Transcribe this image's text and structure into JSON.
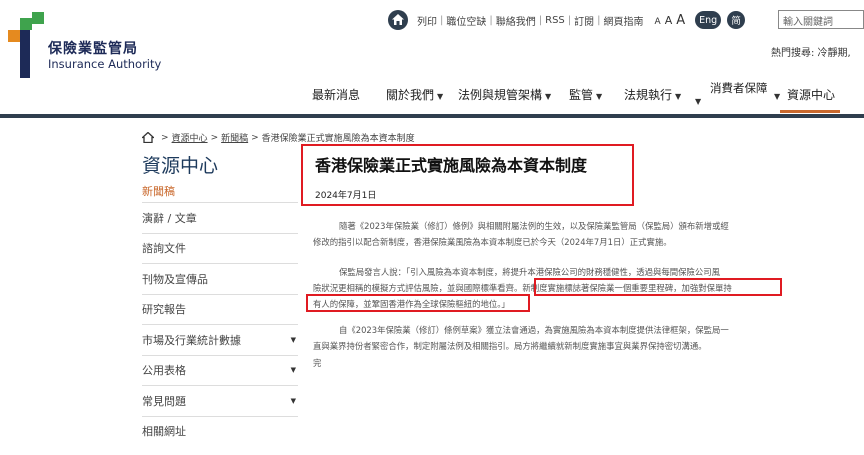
{
  "logo": {
    "zh": "保險業監管局",
    "en": "Insurance Authority"
  },
  "utility": {
    "links": [
      "列印",
      "職位空缺",
      "聯絡我們",
      "RSS",
      "訂閱",
      "網頁指南"
    ],
    "font_sizes": [
      "A",
      "A",
      "A"
    ],
    "lang_en": "Eng",
    "lang_sc": "简",
    "search_placeholder": "輸入關鍵詞",
    "hot_search": "熱門搜尋: 冷靜期,"
  },
  "nav": {
    "items": [
      "最新消息",
      "關於我們",
      "法例與規管架構",
      "監管",
      "法規執行",
      "消費者保障",
      "資源中心"
    ],
    "active": "資源中心"
  },
  "breadcrumb": [
    "資源中心",
    "新聞稿",
    "香港保險業正式實施風險為本資本制度"
  ],
  "sidebar": {
    "title": "資源中心",
    "active_item": "新聞稿",
    "items": [
      {
        "label": "演辭 / 文章",
        "expandable": false
      },
      {
        "label": "諮詢文件",
        "expandable": false
      },
      {
        "label": "刊物及宣傳品",
        "expandable": false
      },
      {
        "label": "研究報告",
        "expandable": false
      },
      {
        "label": "市場及行業統計數據",
        "expandable": true
      },
      {
        "label": "公用表格",
        "expandable": true
      },
      {
        "label": "常見問題",
        "expandable": true
      },
      {
        "label": "相關網址",
        "expandable": false
      }
    ]
  },
  "article": {
    "title": "香港保險業正式實施風險為本資本制度",
    "date": "2024年7月1日",
    "p1_line1": "隨著《2023年保險業（修訂）條例》與相關附屬法例的生效，以及保險業監管局（保監局）頒布新增或經",
    "p1_line2": "修改的指引以配合新制度，香港保險業風險為本資本制度已於今天（2024年7月1日）正式實施。",
    "p2_line1": "保監局發言人說：「引入風險為本資本制度，將提升本港保險公司的財務穩健性，透過與每間保險公司風",
    "p2_line2": "險狀況更相稱的模擬方式評估風險，並與國際標準看齊。新制度實施標誌著保險業一個重要里程碑，加強對保單持",
    "p2_line3": "有人的保障，並鞏固香港作為全球保險樞紐的地位。」",
    "p3_line1": "自《2023年保險業（修訂）條例草案》獲立法會通過，為實施風險為本資本制度提供法律框架，保監局一",
    "p3_line2": "直與業界持份者緊密合作，制定附屬法例及相關指引。局方將繼續就新制度實施事宜與業界保持密切溝通。",
    "end": "完"
  }
}
